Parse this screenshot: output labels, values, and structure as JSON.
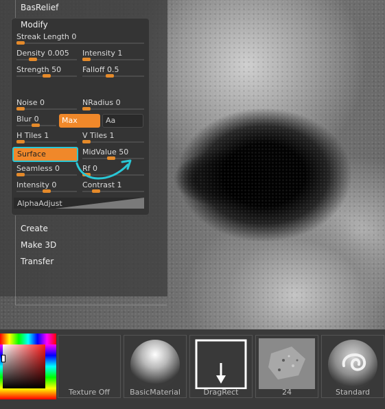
{
  "menu": {
    "basrelief": "BasRelief",
    "modify": "Modify",
    "create": "Create",
    "make3d": "Make 3D",
    "transfer": "Transfer"
  },
  "sliders": {
    "streak_length": {
      "label": "Streak Length 0",
      "value": 0
    },
    "density": {
      "label": "Density 0.005",
      "value": 0.005
    },
    "intensity1": {
      "label": "Intensity 1",
      "value": 1
    },
    "strength": {
      "label": "Strength 50",
      "value": 50
    },
    "falloff": {
      "label": "Falloff 0.5",
      "value": 0.5
    },
    "noise": {
      "label": "Noise 0",
      "value": 0
    },
    "nradius": {
      "label": "NRadius 0",
      "value": 0
    },
    "blur": {
      "label": "Blur 0",
      "value": 0
    },
    "htiles": {
      "label": "H Tiles 1",
      "value": 1
    },
    "vtiles": {
      "label": "V Tiles 1",
      "value": 1
    },
    "midvalue": {
      "label": "MidValue 50",
      "value": 50
    },
    "seamless": {
      "label": "Seamless 0",
      "value": 0
    },
    "rf": {
      "label": "Rf 0",
      "value": 0
    },
    "intensity0": {
      "label": "Intensity 0",
      "value": 0
    },
    "contrast": {
      "label": "Contrast 1",
      "value": 1
    }
  },
  "buttons": {
    "max": "Max",
    "aa": "Aa",
    "surface": "Surface",
    "alpha_adjust": "AlphaAdjust"
  },
  "tray": {
    "texture_off": "Texture Off",
    "basic_material": "BasicMaterial",
    "drag_rect": "DragRect",
    "alpha_24": "24",
    "standard": "Standard"
  },
  "colors": {
    "accent": "#f0882a",
    "highlight": "#29c7d6"
  }
}
